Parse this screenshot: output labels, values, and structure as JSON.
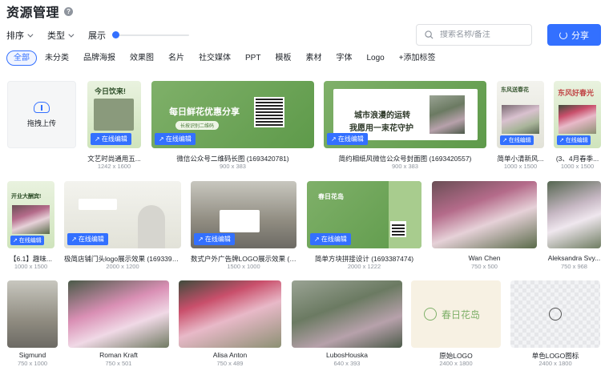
{
  "header": {
    "title": "资源管理",
    "help_icon": "question-circle-icon"
  },
  "toolbar": {
    "sort_label": "排序",
    "type_label": "类型",
    "display_label": "展示",
    "display_level": 0.0
  },
  "search": {
    "placeholder": "搜索名称/备注",
    "icon": "search-icon"
  },
  "share": {
    "label": "分享",
    "icon": "share-icon"
  },
  "tags": [
    "全部",
    "未分类",
    "品牌海报",
    "效果图",
    "名片",
    "社交媒体",
    "PPT",
    "模板",
    "素材",
    "字体",
    "Logo",
    "+添加标签"
  ],
  "active_tag": "全部",
  "upload": {
    "label": "拖拽上传",
    "icon": "cloud-upload-icon"
  },
  "edit_badge": "↗ 在线编辑",
  "cards": [
    {
      "title": "文艺时尚通用五...",
      "dim": "1242 x 1600",
      "inner": "今日饮来!",
      "edit": true
    },
    {
      "title": "微信公众号二维码长图 (1693420781)",
      "dim": "900 x 383",
      "inner": "每日鲜花优惠分享",
      "inner_sub": "长按识别二维码",
      "edit": true
    },
    {
      "title": "简约相纸风微信公众号封面图 (1693420557)",
      "dim": "900 x 383",
      "inner": "城市浪漫的运转",
      "inner2": "我愿用一束花守护",
      "edit": true
    },
    {
      "title": "简单小清新风...",
      "dim": "1000 x 1500",
      "inner": "东风送春花",
      "edit": true
    },
    {
      "title": "(3、4月春季...",
      "dim": "1000 x 1500",
      "inner": "东风好春光",
      "edit": true
    },
    {
      "title": "【6.1】趣味...",
      "dim": "1000 x 1500",
      "inner": "开业大酬宾!",
      "edit": true
    },
    {
      "title": "极简店铺门头logo展示效果 (1693390...",
      "dim": "2000 x 1200",
      "edit": true
    },
    {
      "title": "数式户外广告牌LOGO展示效果 (1...",
      "dim": "1500 x 1000",
      "edit": true
    },
    {
      "title": "简单方块拼接设计 (1693387474)",
      "dim": "2000 x 1222",
      "inner": "春日花岛",
      "edit": true
    },
    {
      "title": "Wan Chen",
      "dim": "750 x 500",
      "edit": false
    },
    {
      "title": "Aleksandra Svy...",
      "dim": "750 x 968",
      "edit": false
    },
    {
      "title": "Sigmund",
      "dim": "750 x 1000",
      "edit": false
    },
    {
      "title": "Roman Kraft",
      "dim": "750 x 501",
      "edit": false
    },
    {
      "title": "Alisa Anton",
      "dim": "750 x 489",
      "edit": false
    },
    {
      "title": "LubosHouska",
      "dim": "640 x 393",
      "edit": false
    },
    {
      "title": "原始LOGO",
      "dim": "2400 x 1800",
      "inner": "春日花岛",
      "edit": false
    },
    {
      "title": "单色LOGO图标",
      "dim": "2400 x 1800",
      "edit": false
    }
  ],
  "colors": {
    "accent": "#3370ff",
    "text": "#1f2329",
    "muted": "#8f959e",
    "green": "#7fb069"
  }
}
